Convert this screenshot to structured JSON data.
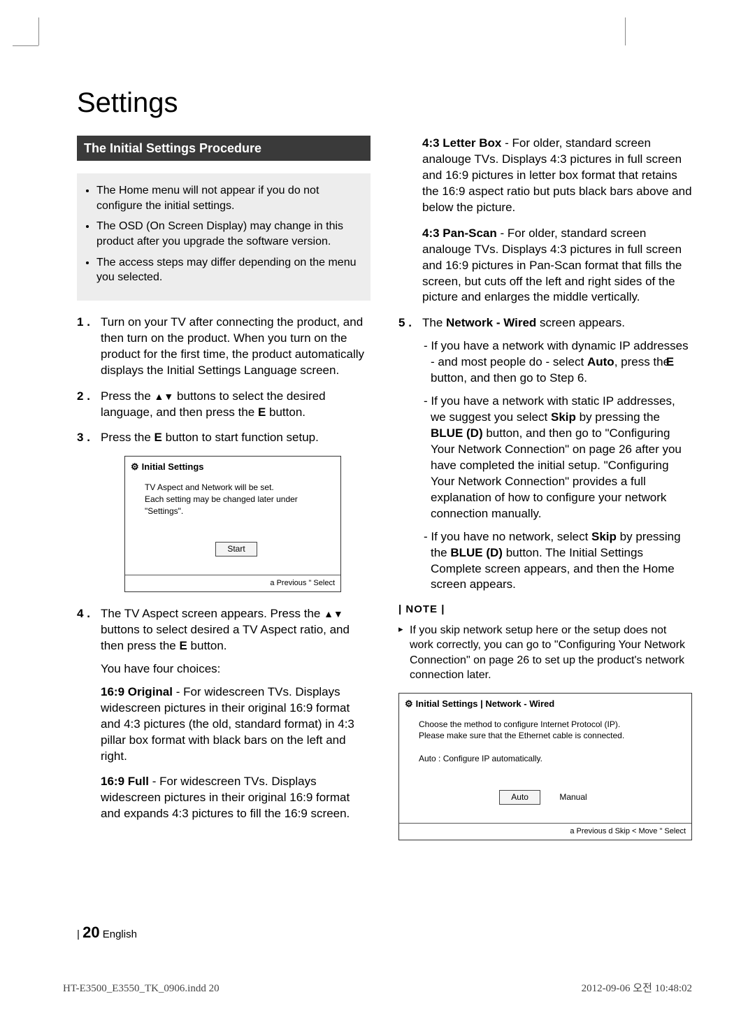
{
  "title": "Settings",
  "section_heading": "The Initial Settings Procedure",
  "top_notes": [
    "The Home menu will not appear if you do not configure the initial settings.",
    "The OSD (On Screen Display) may change in this product after you upgrade the software version.",
    "The access steps may differ depending on the menu you selected."
  ],
  "step1": "Turn on your TV after connecting the product, and then turn on the product. When you turn on the product for the first time, the product automatically displays the Initial Settings Language screen.",
  "step2_a": "Press the ",
  "step2_arrows": "▲▼",
  "step2_b": " buttons to select the desired language, and then press the ",
  "step2_ebtn": "E",
  "step2_c": " button.",
  "step3_a": "Press the ",
  "step3_ebtn": "E",
  "step3_b": " button to start function setup.",
  "osd1": {
    "title": "Initial Settings",
    "line1": "TV Aspect and Network will be set.",
    "line2": "Each setting may be changed later under \"Settings\".",
    "start": "Start",
    "footer_a": "a",
    "footer_prev": " Previous ",
    "footer_sep": "\" ",
    "footer_select": "Select"
  },
  "step4_a": "The TV Aspect screen appears. Press the ",
  "step4_arrows": "▲▼",
  "step4_b": " buttons to select desired a TV Aspect ratio, and then press the ",
  "step4_ebtn": "E",
  "step4_c": " button.",
  "step4_choices": "You have four choices:",
  "aspect_16_9_original": {
    "name": "16:9 Original",
    "desc": " - For widescreen TVs. Displays widescreen pictures in their original 16:9 format and 4:3 pictures (the old, standard format) in 4:3 pillar box format with black bars on the left and right."
  },
  "aspect_16_9_full": {
    "name": "16:9 Full",
    "desc": " - For widescreen TVs. Displays widescreen pictures in their original 16:9 format and expands 4:3 pictures to fill the 16:9 screen."
  },
  "aspect_43_letter": {
    "name": "4:3 Letter Box",
    "desc": " - For older, standard screen analouge TVs. Displays 4:3 pictures in full screen and 16:9 pictures in letter box format that retains the 16:9 aspect ratio but puts black bars above and below the picture."
  },
  "aspect_43_pan": {
    "name": "4:3 Pan-Scan",
    "desc": " - For older, standard screen analouge TVs. Displays 4:3 pictures in full screen and 16:9 pictures in Pan-Scan format that fills the screen, but cuts off the left and right sides of the picture and enlarges the middle vertically."
  },
  "step5_a": "The ",
  "step5_bold": "Network - Wired",
  "step5_b": " screen appears.",
  "dash1_a": "If you have a network with dynamic IP addresses - and most people do - select ",
  "dash1_auto": "Auto",
  "dash1_b": ", press the ",
  "dash1_ebtn": "E",
  "dash1_c": " button, and then go to Step 6.",
  "dash2_a": "If you have a network with static IP addresses, we suggest you select ",
  "dash2_skip": "Skip",
  "dash2_b": " by pressing the ",
  "dash2_blue": "BLUE (D)",
  "dash2_c": " button, and then go to \"Configuring Your Network Connection\" on page 26 after you have completed the initial setup. \"Configuring Your Network Connection\" provides a full explanation of how to configure your network connection manually.",
  "dash3_a": "If you have no network, select ",
  "dash3_skip": "Skip",
  "dash3_b": " by pressing the ",
  "dash3_blue": "BLUE (D)",
  "dash3_c": " button. The Initial Settings Complete screen appears, and then the Home screen appears.",
  "note_heading": "| NOTE |",
  "note_item": "If you skip network setup here or the setup does not work correctly, you can go to \"Configuring Your Network Connection\" on page 26 to set up the product's network connection later.",
  "osd2": {
    "title": "Initial Settings | Network - Wired",
    "line1": "Choose the method to configure Internet Protocol (IP).",
    "line2": "Please make sure that the Ethernet cable is connected.",
    "line3": "Auto : Configure IP automatically.",
    "auto": "Auto",
    "manual": "Manual",
    "footer": "a  Previous d  Skip  <  Move \"  Select"
  },
  "page_number": "20",
  "page_lang": "English",
  "indd_file": "HT-E3500_E3550_TK_0906.indd   20",
  "indd_time": "2012-09-06   오전 10:48:02"
}
